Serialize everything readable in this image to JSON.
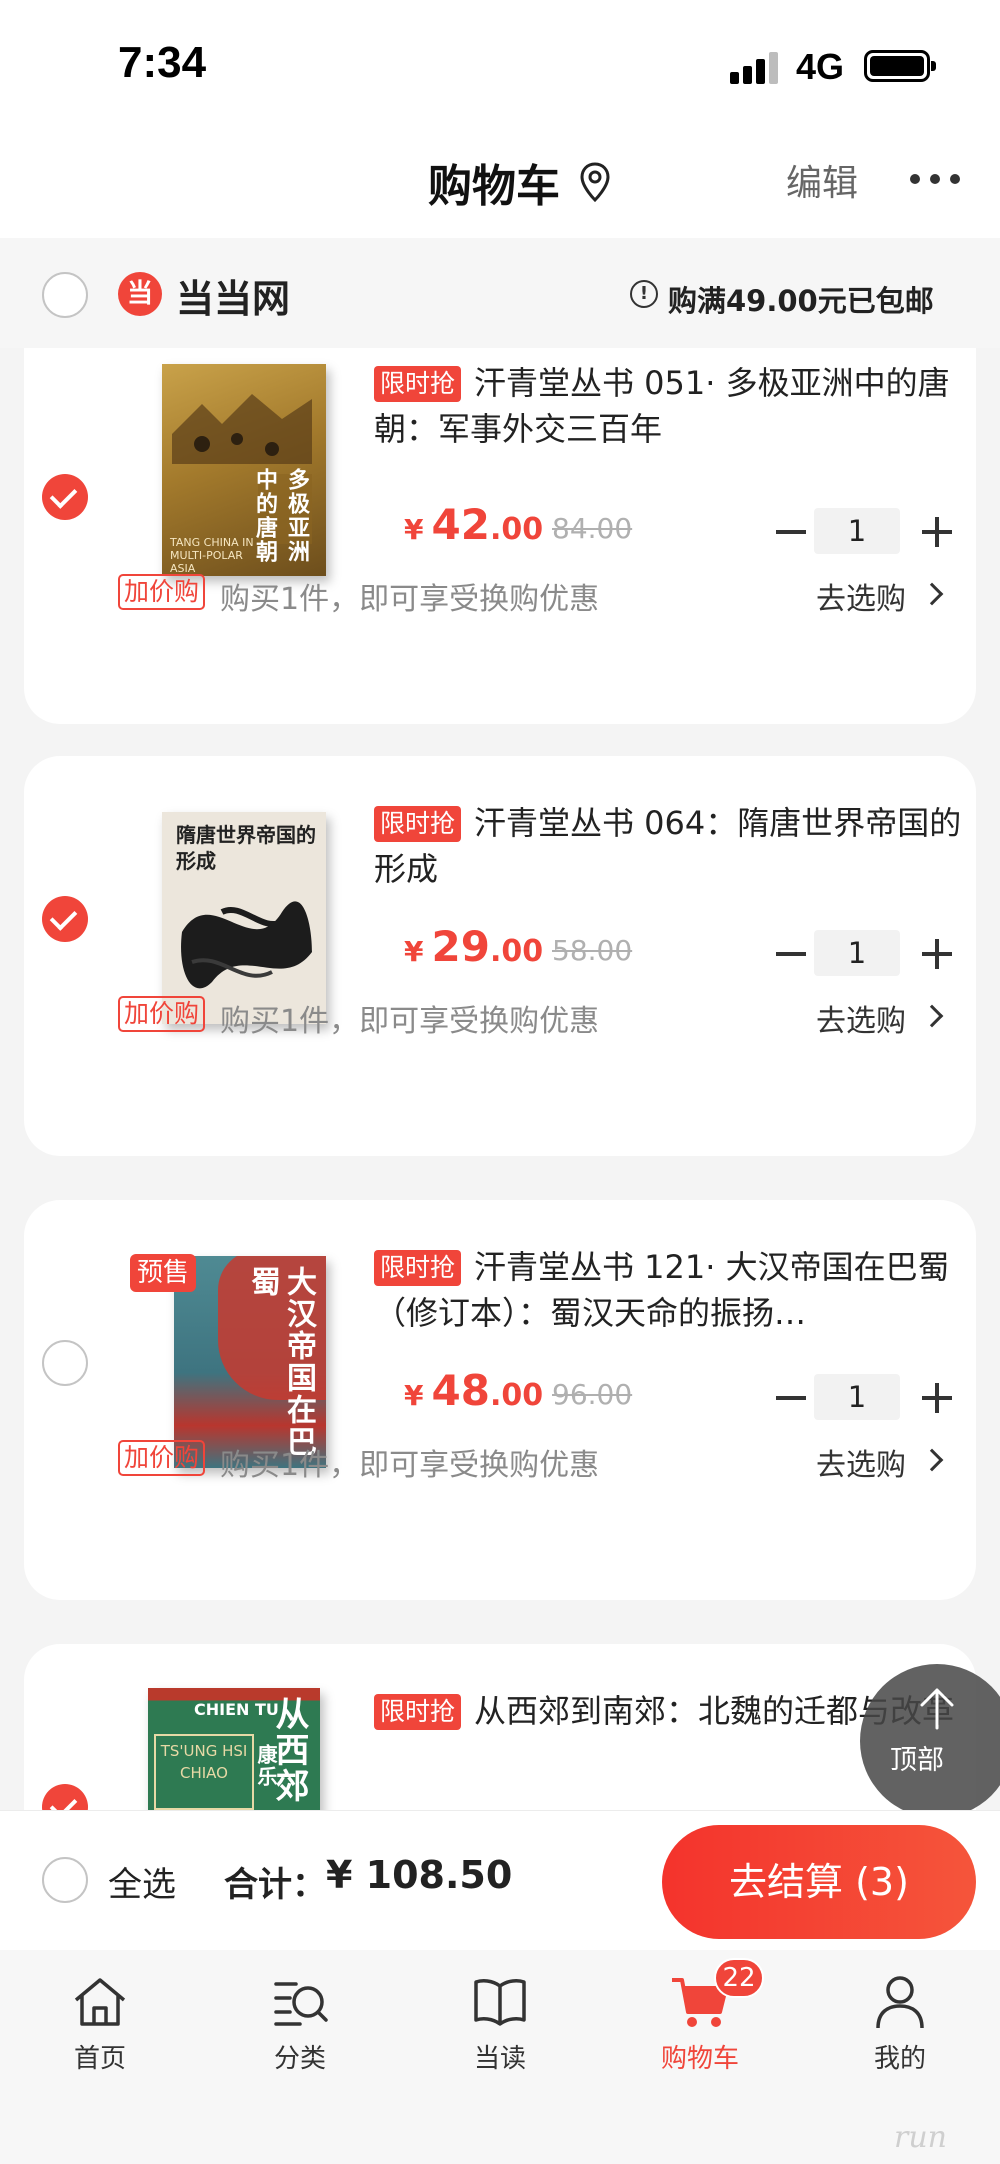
{
  "status_bar": {
    "time": "7:34",
    "network": "4G"
  },
  "nav": {
    "title": "购物车",
    "edit_label": "编辑"
  },
  "shop": {
    "name": "当当网",
    "logo_glyph": "当",
    "shipping_note": "购满49.00元已包邮"
  },
  "items": [
    {
      "selected": true,
      "promo_tag": "限时抢",
      "title": "汗青堂丛书 051· 多极亚洲中的唐朝：军事外交三百年",
      "price_symbol": "¥",
      "price_int": "42",
      "price_dec": ".00",
      "original_price": "84.00",
      "quantity": "1",
      "addon_tag": "加价购",
      "addon_text": "购买1件，即可享受换购优惠",
      "shop_link": "去选购",
      "cover": {
        "title": "多极亚洲中的唐朝",
        "subtitle": "TANG CHINA IN MULTI-POLAR ASIA"
      }
    },
    {
      "selected": true,
      "promo_tag": "限时抢",
      "title": "汗青堂丛书 064：隋唐世界帝国的形成",
      "price_symbol": "¥",
      "price_int": "29",
      "price_dec": ".00",
      "original_price": "58.00",
      "quantity": "1",
      "addon_tag": "加价购",
      "addon_text": "购买1件，即可享受换购优惠",
      "shop_link": "去选购",
      "cover": {
        "title": "隋唐世界帝国的形成"
      }
    },
    {
      "selected": false,
      "presale_badge": "预售",
      "promo_tag": "限时抢",
      "title": "汗青堂丛书 121· 大汉帝国在巴蜀（修订本）：蜀汉天命的振扬…",
      "price_symbol": "¥",
      "price_int": "48",
      "price_dec": ".00",
      "original_price": "96.00",
      "quantity": "1",
      "addon_tag": "加价购",
      "addon_text": "购买1件，即可享受换购优惠",
      "shop_link": "去选购",
      "cover": {
        "title": "大汉帝国在巴蜀"
      }
    },
    {
      "selected": true,
      "promo_tag": "限时抢",
      "title": "从西郊到南郊：北魏的迁都与改革",
      "cover": {
        "title": "从西郊",
        "latin": "TS'UNG HSI CHIAO",
        "top_text": "CHIEN TU",
        "author": "康乐"
      }
    }
  ],
  "back_to_top": {
    "label": "顶部"
  },
  "summary": {
    "select_all_label": "全选",
    "total_label": "合计：",
    "total_value": "¥ 108.50",
    "checkout_label": "去结算 (3)"
  },
  "tab_bar": {
    "tabs": [
      {
        "label": "首页",
        "icon": "home-icon"
      },
      {
        "label": "分类",
        "icon": "category-search-icon"
      },
      {
        "label": "当读",
        "icon": "book-icon"
      },
      {
        "label": "购物车",
        "icon": "cart-icon",
        "badge": "22",
        "active": true
      },
      {
        "label": "我的",
        "icon": "profile-icon"
      }
    ]
  },
  "watermark": "run",
  "colors": {
    "accent": "#f0453a",
    "checkout_start": "#f4332c",
    "checkout_end": "#f5553b"
  }
}
